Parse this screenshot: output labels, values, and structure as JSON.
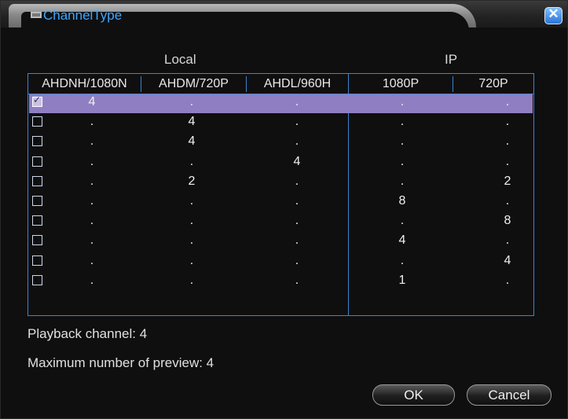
{
  "dialog": {
    "title": "ChannelType",
    "close_glyph": "✕"
  },
  "groups": {
    "local": "Local",
    "ip": "IP"
  },
  "columns": [
    "AHDNH/1080N",
    "AHDM/720P",
    "AHDL/960H",
    "1080P",
    "720P"
  ],
  "rows": [
    {
      "checked": true,
      "values": [
        "4",
        ".",
        ".",
        ".",
        "."
      ]
    },
    {
      "checked": false,
      "values": [
        ".",
        "4",
        ".",
        ".",
        "."
      ]
    },
    {
      "checked": false,
      "values": [
        ".",
        "4",
        ".",
        ".",
        "."
      ]
    },
    {
      "checked": false,
      "values": [
        ".",
        ".",
        "4",
        ".",
        "."
      ]
    },
    {
      "checked": false,
      "values": [
        ".",
        "2",
        ".",
        ".",
        "2"
      ]
    },
    {
      "checked": false,
      "values": [
        ".",
        ".",
        ".",
        "8",
        "."
      ]
    },
    {
      "checked": false,
      "values": [
        ".",
        ".",
        ".",
        ".",
        "8"
      ]
    },
    {
      "checked": false,
      "values": [
        ".",
        ".",
        ".",
        "4",
        "."
      ]
    },
    {
      "checked": false,
      "values": [
        ".",
        ".",
        ".",
        ".",
        "4"
      ]
    },
    {
      "checked": false,
      "values": [
        ".",
        ".",
        ".",
        "1",
        "."
      ]
    }
  ],
  "info": {
    "playback": "Playback channel: 4",
    "preview": "Maximum number of preview: 4"
  },
  "buttons": {
    "ok": "OK",
    "cancel": "Cancel"
  },
  "colors": {
    "accent": "#3ea7ff",
    "selected_row": "#8f7fc2",
    "grid": "#3a86d0"
  },
  "icons": {
    "title": "window-icon",
    "close": "close-icon",
    "checkbox_tick": "check-icon"
  }
}
